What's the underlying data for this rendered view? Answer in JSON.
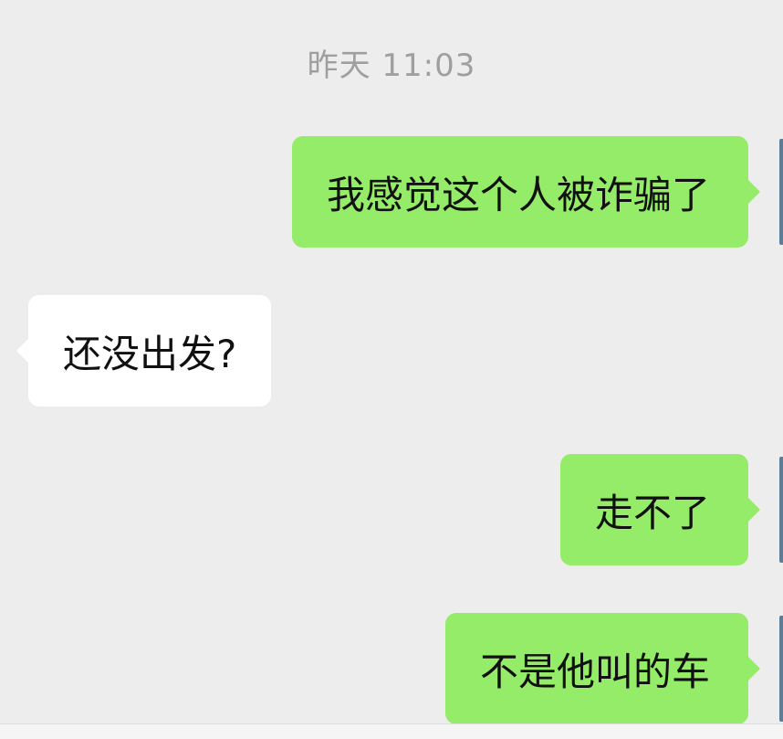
{
  "conversation": {
    "timestamp": "昨天 11:03",
    "messages": [
      {
        "direction": "sent",
        "text": "我感觉这个人被诈骗了"
      },
      {
        "direction": "received",
        "text": "还没出发?"
      },
      {
        "direction": "sent",
        "text": "走不了"
      },
      {
        "direction": "sent",
        "text": "不是他叫的车"
      }
    ]
  },
  "colors": {
    "background": "#ededed",
    "sent_bubble": "#95ec69",
    "received_bubble": "#ffffff",
    "timestamp_text": "#9f9f9f",
    "message_text": "#111111"
  }
}
